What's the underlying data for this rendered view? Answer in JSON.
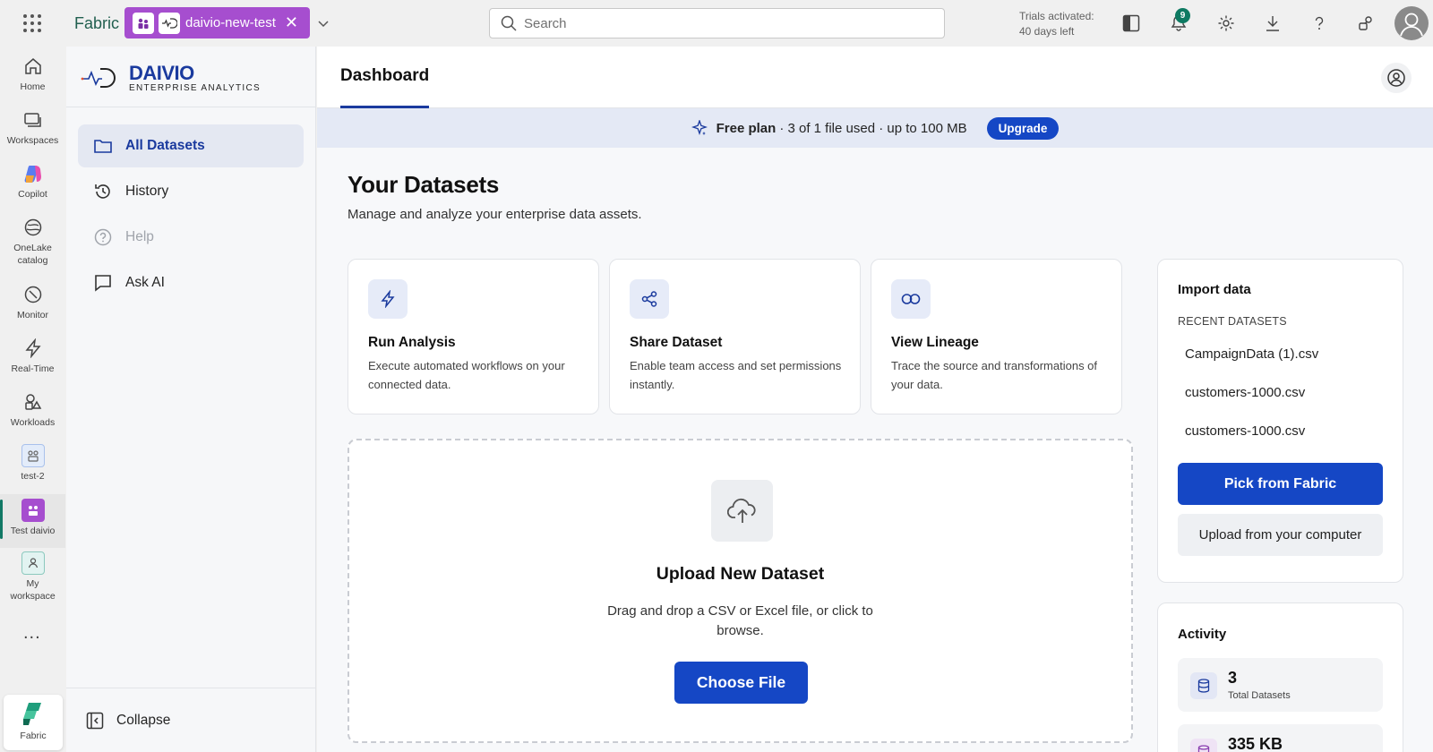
{
  "topbar": {
    "brand": "Fabric",
    "workspace_pill": "daivio-new-test",
    "search_placeholder": "Search",
    "trial_line1": "Trials activated:",
    "trial_line2": "40 days left",
    "notification_count": "9"
  },
  "rail": {
    "items": [
      {
        "label": "Home",
        "icon": "home-icon"
      },
      {
        "label": "Workspaces",
        "icon": "workspaces-icon"
      },
      {
        "label": "Copilot",
        "icon": "copilot-icon"
      },
      {
        "label": "OneLake catalog",
        "icon": "onelake-icon"
      },
      {
        "label": "Monitor",
        "icon": "monitor-icon"
      },
      {
        "label": "Real-Time",
        "icon": "lightning-icon"
      },
      {
        "label": "Workloads",
        "icon": "workloads-icon"
      },
      {
        "label": "test-2",
        "icon": "workspace-icon"
      },
      {
        "label": "Test daivio",
        "icon": "workspace-icon"
      },
      {
        "label": "My workspace",
        "icon": "person-icon"
      }
    ],
    "more": "...",
    "fabric_label": "Fabric"
  },
  "app": {
    "logo_title": "DAIVIO",
    "logo_subtitle": "ENTERPRISE ANALYTICS",
    "nav": [
      {
        "label": "All Datasets",
        "icon": "folder-icon"
      },
      {
        "label": "History",
        "icon": "history-icon"
      },
      {
        "label": "Help",
        "icon": "help-icon"
      },
      {
        "label": "Ask AI",
        "icon": "chat-icon"
      }
    ],
    "collapse": "Collapse"
  },
  "main": {
    "tab": "Dashboard",
    "plan": {
      "bold": "Free plan",
      "text": "· 3 of 1 file used · up to 100 MB",
      "upgrade": "Upgrade"
    },
    "title": "Your Datasets",
    "subtitle": "Manage and analyze your enterprise data assets.",
    "cards": [
      {
        "title": "Run Analysis",
        "desc": "Execute automated workflows on your connected data.",
        "icon": "lightning-icon"
      },
      {
        "title": "Share Dataset",
        "desc": "Enable team access and set permissions instantly.",
        "icon": "share-icon"
      },
      {
        "title": "View Lineage",
        "desc": "Trace the source and transformations of your data.",
        "icon": "link-icon"
      }
    ],
    "upload": {
      "title": "Upload New Dataset",
      "desc": "Drag and drop a CSV or Excel file, or click to browse.",
      "button": "Choose File"
    },
    "import": {
      "title": "Import data",
      "recent_header": "RECENT DATASETS",
      "recent": [
        "CampaignData (1).csv",
        "customers-1000.csv",
        "customers-1000.csv"
      ],
      "pick": "Pick from Fabric",
      "upload_pc": "Upload from your computer"
    },
    "activity": {
      "title": "Activity",
      "stats": [
        {
          "value": "3",
          "label": "Total Datasets"
        },
        {
          "value": "335 KB",
          "label": ""
        }
      ]
    }
  },
  "colors": {
    "accent": "#1547c5",
    "fabric_green": "#117865",
    "workspace_purple": "#a64ecf"
  }
}
